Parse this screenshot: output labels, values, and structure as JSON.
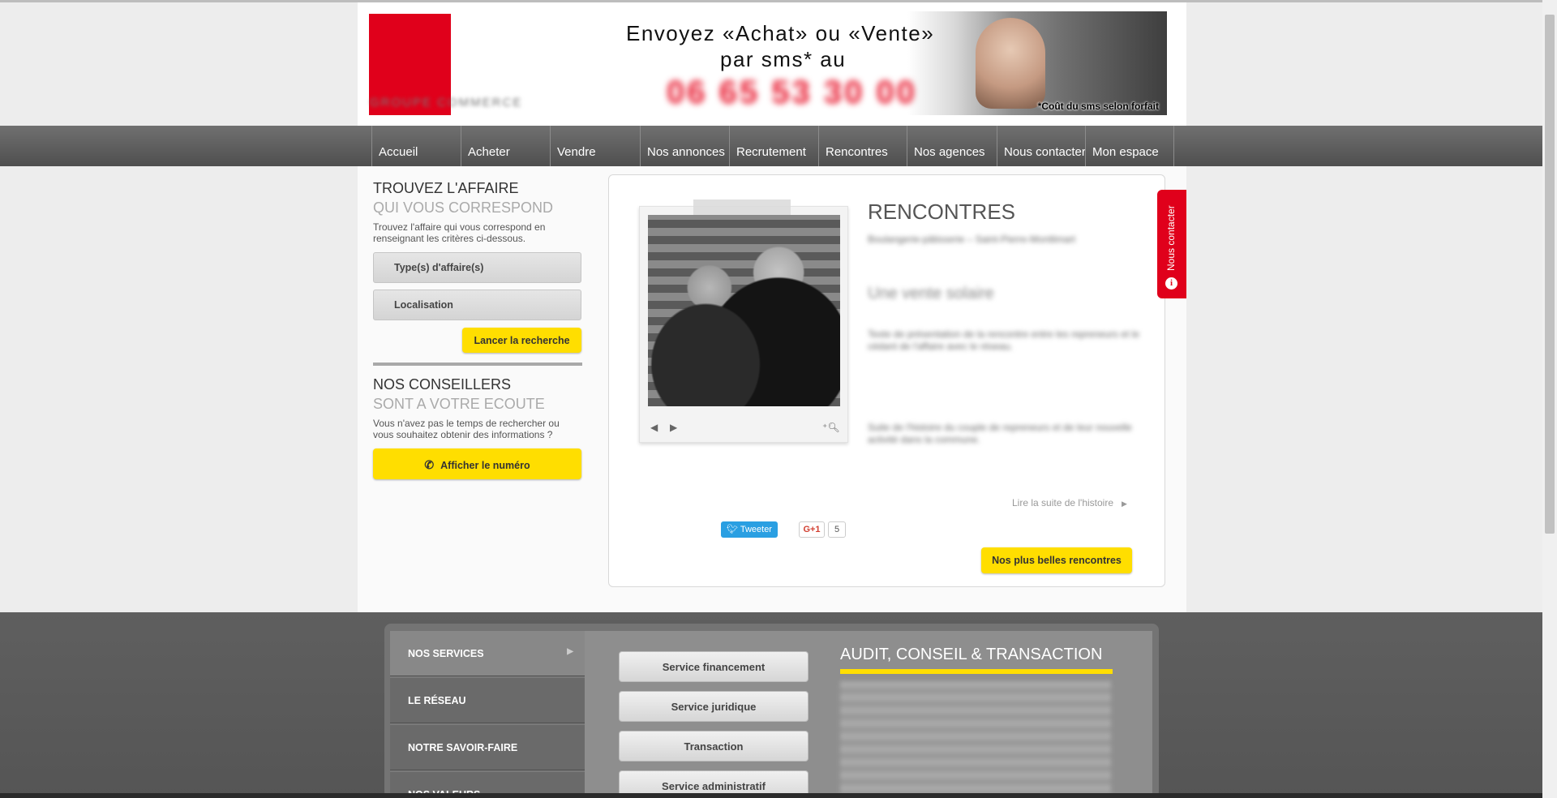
{
  "header": {
    "logo_text": "GROUPE COMMERCE",
    "banner": {
      "line1": "Envoyez «Achat» ou «Vente»",
      "line2": "par sms* au",
      "phone": "06 65 53 30 00",
      "note": "*Coût du sms selon forfait"
    }
  },
  "nav": {
    "items": [
      {
        "label": "Accueil"
      },
      {
        "label": "Acheter"
      },
      {
        "label": "Vendre"
      },
      {
        "label": "Nos annonces"
      },
      {
        "label": "Recrutement"
      },
      {
        "label": "Rencontres"
      },
      {
        "label": "Nos agences"
      },
      {
        "label": "Nous contacter"
      },
      {
        "label": "Mon espace"
      }
    ]
  },
  "sidebar": {
    "search": {
      "title": "TROUVEZ L'AFFAIRE",
      "subtitle": "QUI VOUS CORRESPOND",
      "desc": "Trouvez l'affaire qui vous correspond en renseignant les critères ci-dessous.",
      "type_label": "Type(s) d'affaire(s)",
      "location_label": "Localisation",
      "search_button": "Lancer la recherche"
    },
    "advisors": {
      "title": "NOS CONSEILLERS",
      "subtitle": "SONT A VOTRE ECOUTE",
      "desc": "Vous n'avez pas le temps de rechercher ou vous souhaitez obtenir des informations ?",
      "button": "Afficher le numéro"
    }
  },
  "rencontres": {
    "title": "RENCONTRES",
    "intro": "Boulangerie-pâtisserie – Saint-Pierre-Montlimart",
    "quote": "Une vente solaire",
    "body1": "Texte de présentation de la rencontre entre les repreneurs et le cédant de l'affaire avec le réseau.",
    "body2": "Suite de l'histoire du couple de repreneurs et de leur nouvelle activité dans la commune.",
    "read_more": "Lire la suite de l'histoire",
    "tweet": "Tweeter",
    "gplus": "G+1",
    "gplus_count": "5",
    "best_button": "Nos plus belles rencontres"
  },
  "contact_tab": {
    "label": "Nous contacter"
  },
  "footer": {
    "menu": [
      {
        "label": "NOS SERVICES"
      },
      {
        "label": "LE RÉSEAU"
      },
      {
        "label": "NOTRE SAVOIR-FAIRE"
      },
      {
        "label": "NOS VALEURS"
      }
    ],
    "services": [
      {
        "label": "Service financement"
      },
      {
        "label": "Service juridique"
      },
      {
        "label": "Transaction"
      },
      {
        "label": "Service administratif"
      }
    ],
    "section_title": "AUDIT, CONSEIL & TRANSACTION"
  },
  "colors": {
    "brand_red": "#e0001b",
    "accent_yellow": "#ffde00",
    "nav_gray": "#5c5c5c"
  }
}
